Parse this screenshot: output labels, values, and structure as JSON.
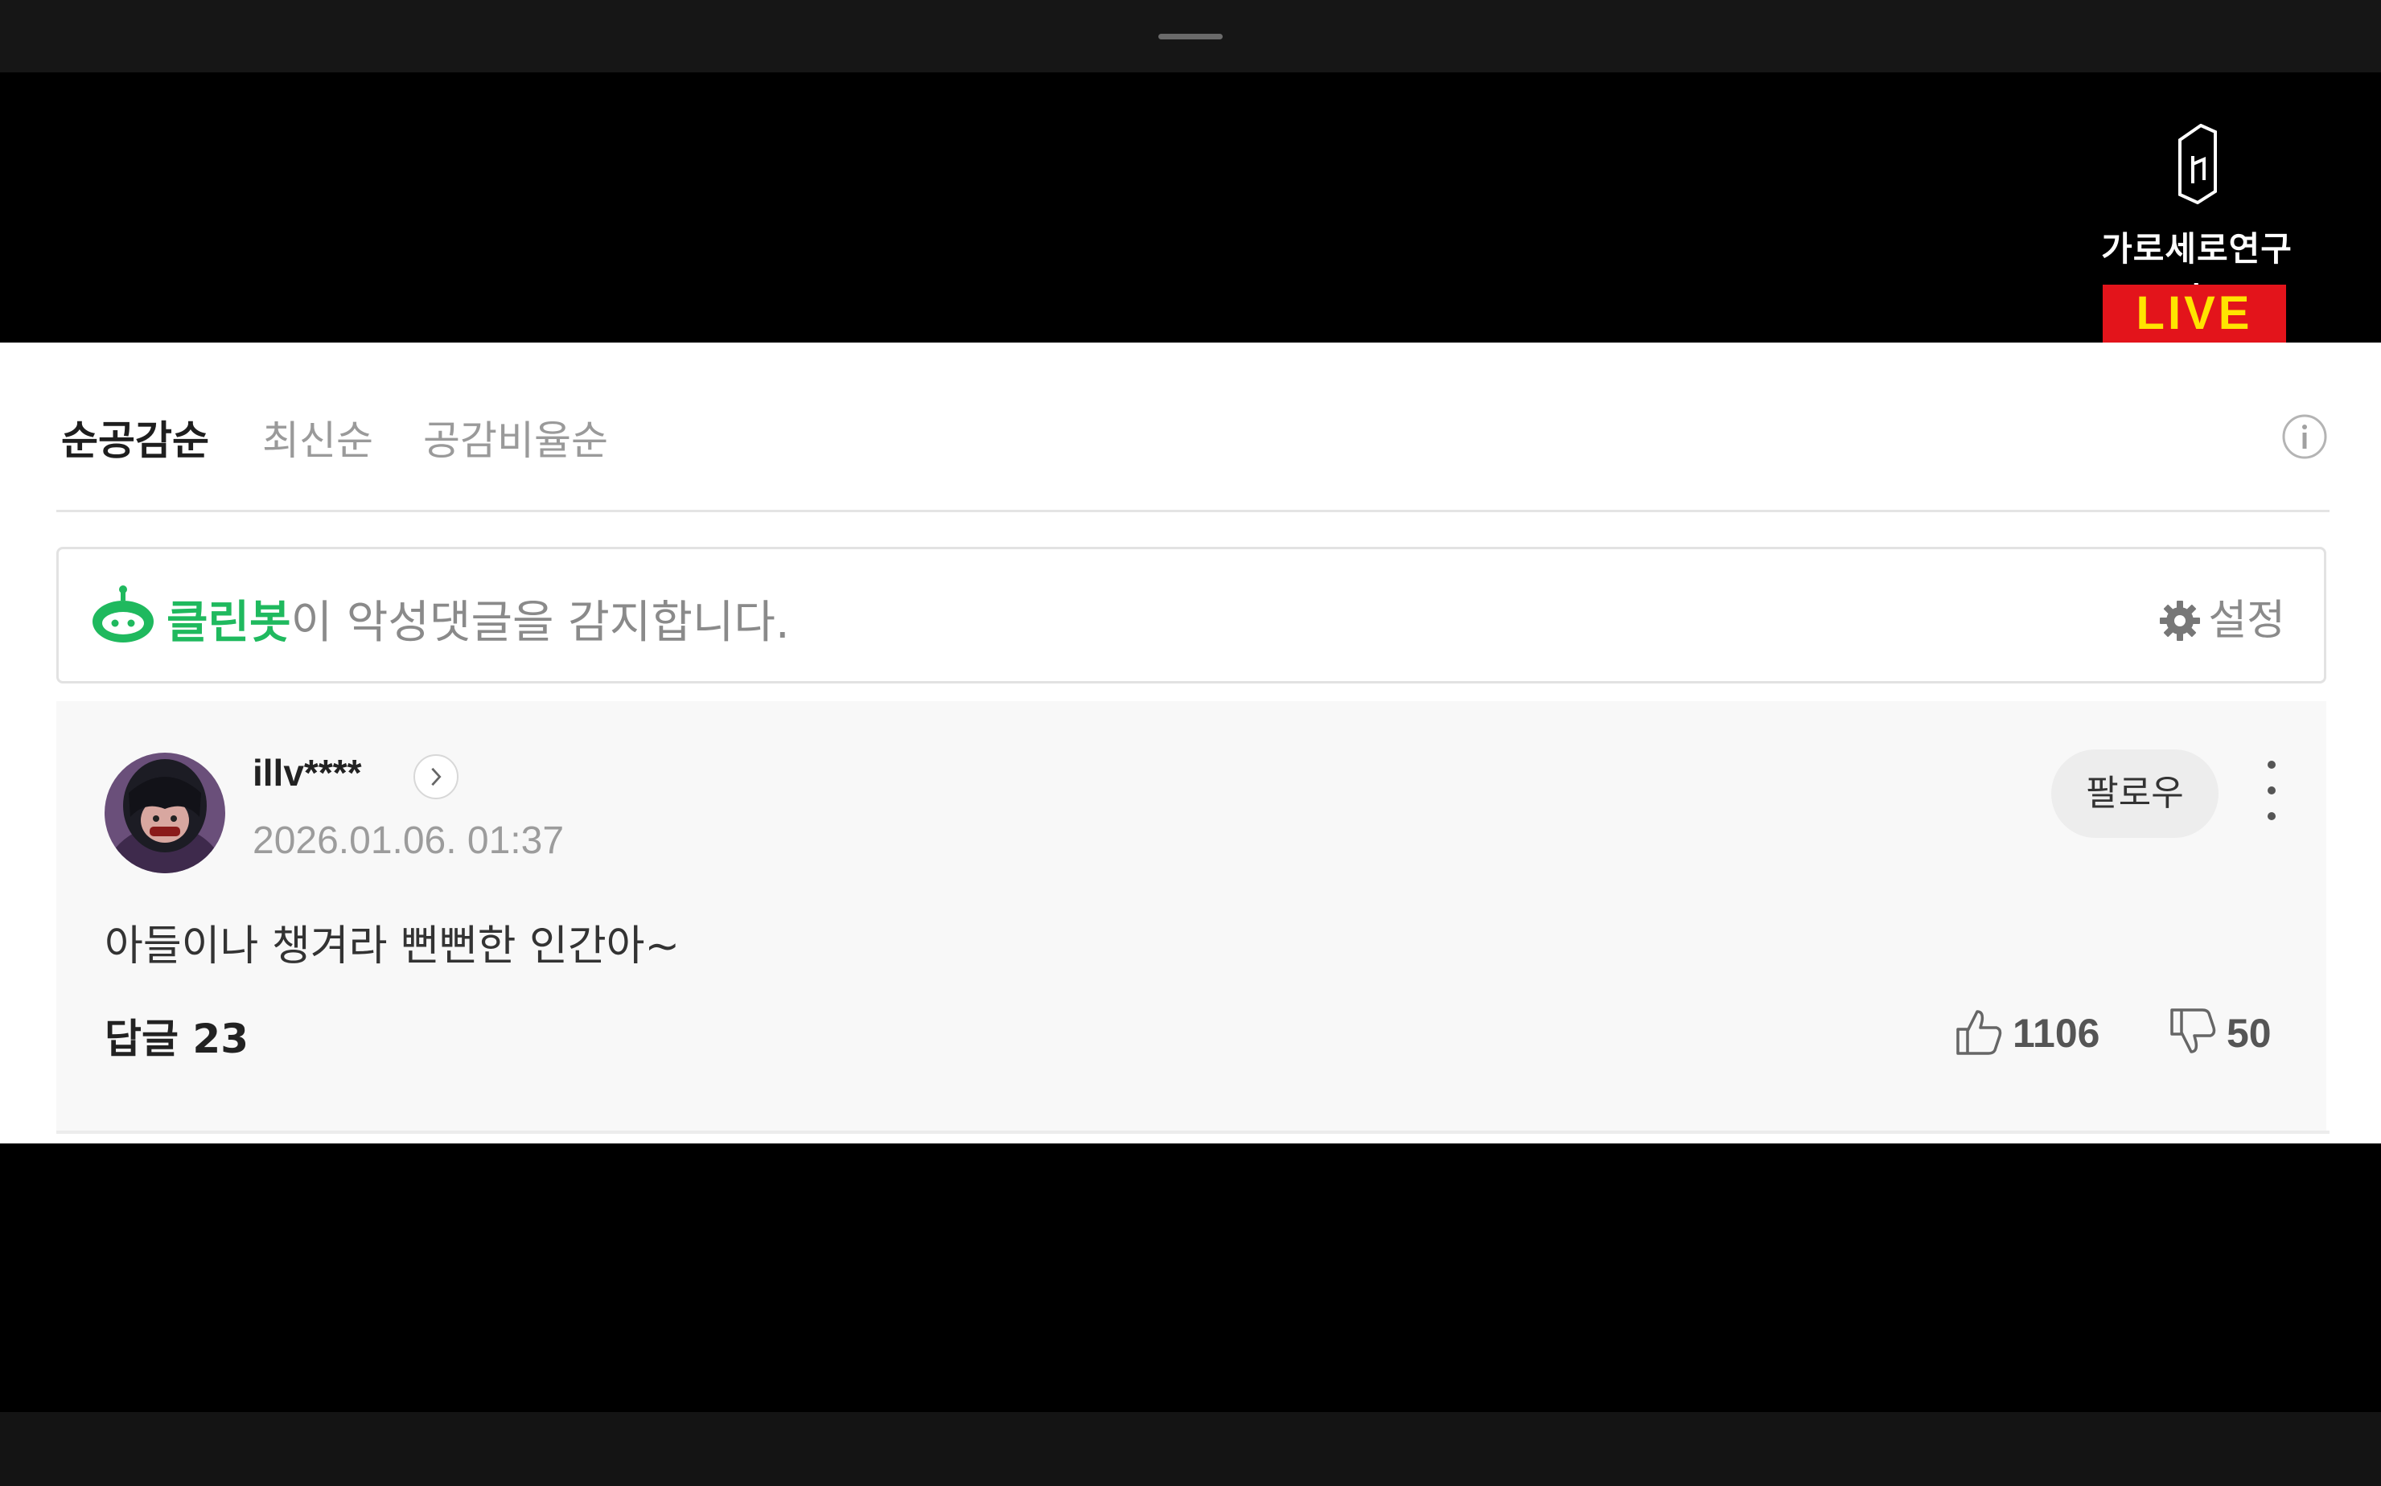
{
  "overlay": {
    "logo_text": "가로세로연구소",
    "live_label": "LIVE",
    "live_color": "#e3141b",
    "live_text_color": "#ffe400"
  },
  "sort_tabs": [
    {
      "label": "순공감순",
      "active": true
    },
    {
      "label": "최신순",
      "active": false
    },
    {
      "label": "공감비율순",
      "active": false
    }
  ],
  "cleanbot": {
    "brand": "클린봇",
    "message": "이 악성댓글을 감지합니다.",
    "settings_label": "설정",
    "brand_color": "#1fb95e"
  },
  "comment": {
    "username": "illv****",
    "timestamp": "2026.01.06. 01:37",
    "follow_label": "팔로우",
    "text": "아들이나 챙겨라 뻔뻔한 인간아~",
    "replies_label": "답글",
    "replies_count": "23",
    "likes": "1106",
    "dislikes": "50"
  }
}
